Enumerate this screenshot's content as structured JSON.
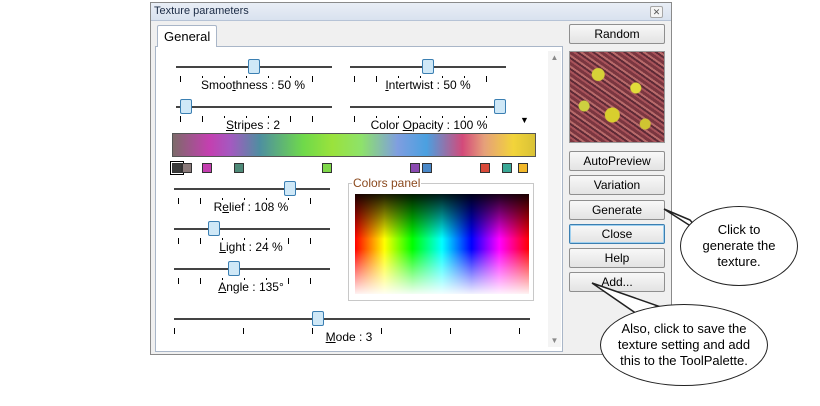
{
  "window": {
    "title": "Texture parameters",
    "close_glyph": "✕"
  },
  "tabs": [
    {
      "label": "General"
    }
  ],
  "sliders": {
    "smoothness": {
      "label_pre": "Smoo",
      "label_ul": "t",
      "label_post": "hness : 50 %",
      "value": 0.5
    },
    "intertwist": {
      "label_pre": "",
      "label_ul": "I",
      "label_post": "ntertwist : 50 %",
      "value": 0.5
    },
    "stripes": {
      "label_pre": "",
      "label_ul": "S",
      "label_post": "tripes : 2",
      "value": 0.0
    },
    "color_opacity": {
      "label_pre": "Color ",
      "label_ul": "O",
      "label_post": "pacity : 100 %",
      "value": 1.0
    },
    "relief": {
      "label_pre": "R",
      "label_ul": "e",
      "label_post": "lief : 108 %",
      "value": 0.75
    },
    "light": {
      "label_pre": "",
      "label_ul": "L",
      "label_post": "ight : 24 %",
      "value": 0.24
    },
    "angle": {
      "label_pre": "",
      "label_ul": "A",
      "label_post": "ngle : 135°",
      "value": 0.375
    },
    "mode": {
      "label_pre": "",
      "label_ul": "M",
      "label_post": "ode : 3",
      "value": 0.4
    }
  },
  "color_stops": [
    "#3a3a3a",
    "#8a7a7a",
    "#c43fb0",
    "#4e8a78",
    "#7fd84a",
    "#8a4ab0",
    "#4a88c8",
    "#d94a3a",
    "#3aa896",
    "#f2b82a"
  ],
  "colors_panel_label": "Colors panel",
  "buttons": {
    "random": "Random",
    "autopreview": "AutoPreview",
    "variation": "Variation",
    "generate": "Generate",
    "close": "Close",
    "help": "Help",
    "add": "Add..."
  },
  "callouts": {
    "generate": "Click to generate the texture.",
    "add": "Also, click to save the texture setting and add this to the ToolPalette."
  },
  "scroll": {
    "up": "▲",
    "down": "▼"
  },
  "dropdown_glyph": "▼"
}
